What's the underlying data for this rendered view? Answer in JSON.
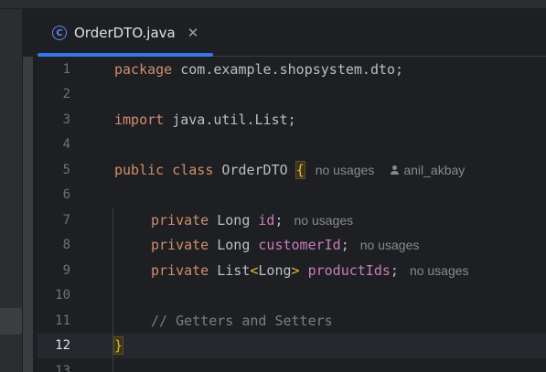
{
  "tab": {
    "label": "OrderDTO.java",
    "icon": "class-icon",
    "icon_glyph": "C",
    "close_glyph": "✕"
  },
  "colors": {
    "keyword": "#cf8e6d",
    "field": "#c77dbb",
    "bracket": "#e8ba36",
    "comment": "#7a7e85",
    "accent": "#3574f0"
  },
  "editor": {
    "current_line": 12,
    "line_numbers": [
      "1",
      "2",
      "3",
      "4",
      "5",
      "6",
      "7",
      "8",
      "9",
      "10",
      "11",
      "12",
      "13"
    ],
    "lines": {
      "l1": {
        "kw": "package",
        "rest": " com.example.shopsystem.dto;"
      },
      "l3": {
        "kw": "import",
        "rest": " java.util.List;"
      },
      "l5": {
        "kw1": "public",
        "kw2": "class",
        "name": "OrderDTO",
        "brace": "{",
        "hint": "no usages",
        "author": "anil_akbay"
      },
      "l7": {
        "kw": "private",
        "type": "Long",
        "field": "id",
        "semi": ";",
        "hint": "no usages"
      },
      "l8": {
        "kw": "private",
        "type": "Long",
        "field": "customerId",
        "semi": ";",
        "hint": "no usages"
      },
      "l9": {
        "kw": "private",
        "type": "List",
        "gen_open": "<",
        "gen_type": "Long",
        "gen_close": ">",
        "field": "productIds",
        "semi": ";",
        "hint": "no usages"
      },
      "l11": {
        "comment": "// Getters and Setters"
      },
      "l12": {
        "brace": "}"
      }
    }
  }
}
